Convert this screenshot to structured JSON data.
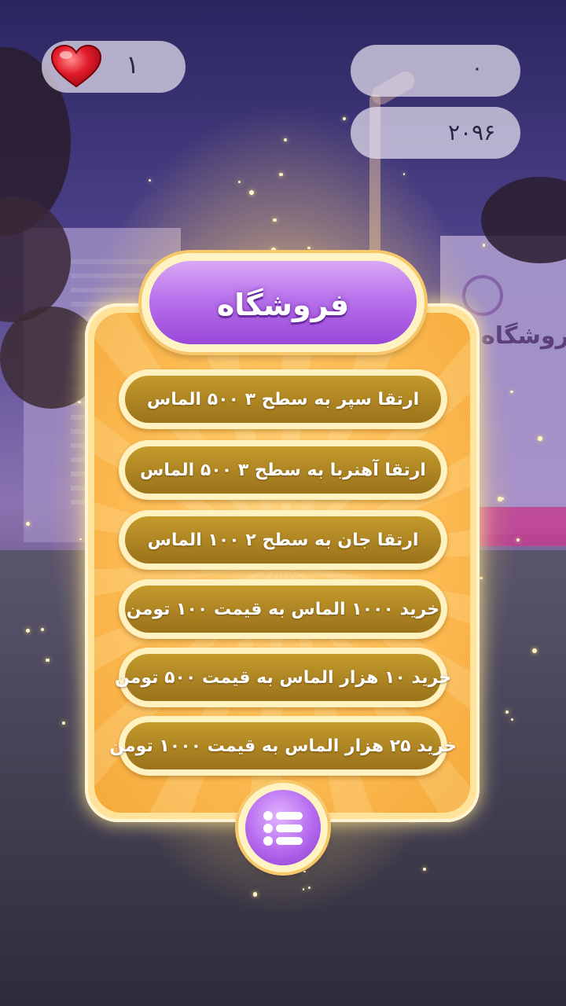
{
  "hud": {
    "lives": "۱",
    "coins": "۰",
    "gems": "۲۰۹۶"
  },
  "background": {
    "shop_sign": "فروشگاه"
  },
  "shop": {
    "title": "فروشگاه",
    "items": [
      {
        "label": "ارتقا سپر به سطح ۳    ۵۰۰ الماس"
      },
      {
        "label": "ارتقا آهنربا به سطح ۳    ۵۰۰ الماس"
      },
      {
        "label": "ارتقا جان به سطح ۲    ۱۰۰ الماس"
      },
      {
        "label": "خرید ۱۰۰۰ الماس به قیمت ۱۰۰ تومن"
      },
      {
        "label": "خرید ۱۰ هزار الماس به قیمت ۵۰۰ تومن"
      },
      {
        "label": "خرید ۲۵ هزار الماس به قیمت ۱۰۰۰ تومن"
      }
    ]
  },
  "icons": {
    "heart": "heart-icon",
    "menu": "menu-list-icon"
  }
}
